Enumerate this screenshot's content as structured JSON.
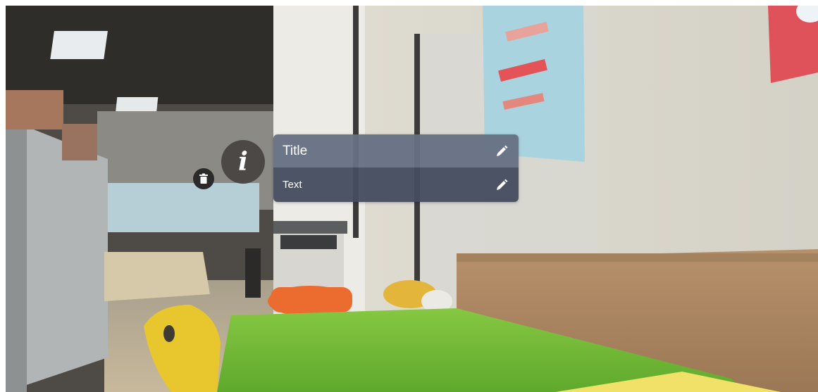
{
  "hotspot": {
    "info_glyph": "i",
    "info_icon": "info-icon",
    "delete_icon": "trash-icon"
  },
  "popup": {
    "title": "Title",
    "text": "Text",
    "edit_icon": "pencil-icon"
  },
  "colors": {
    "popup_title_bg": "#677084",
    "popup_text_bg": "#454d60",
    "hotspot_bg": "#464240",
    "delete_bg": "#2b2b2b"
  }
}
